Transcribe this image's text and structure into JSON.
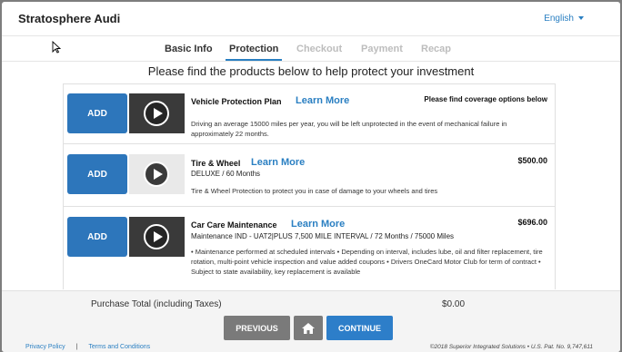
{
  "header": {
    "brand": "Stratosphere Audi",
    "language": "English"
  },
  "tabs": [
    {
      "label": "Basic Info",
      "state": "done"
    },
    {
      "label": "Protection",
      "state": "active"
    },
    {
      "label": "Checkout",
      "state": "pending"
    },
    {
      "label": "Payment",
      "state": "pending"
    },
    {
      "label": "Recap",
      "state": "pending"
    }
  ],
  "heading": "Please find the products below to help protect your investment",
  "products": [
    {
      "add_label": "ADD",
      "title": "Vehicle Protection Plan",
      "learn_more": "Learn More",
      "price": "Please find coverage options below",
      "subtitle": "",
      "description": "Driving an average 15000 miles per year, you will be left unprotected in the event of mechanical failure in approximately 22 months."
    },
    {
      "add_label": "ADD",
      "title": "Tire & Wheel",
      "learn_more": "Learn More",
      "price": "$500.00",
      "subtitle": "DELUXE / 60 Months",
      "description": "Tire & Wheel Protection to protect you in case of damage to your wheels and tires"
    },
    {
      "add_label": "ADD",
      "title": "Car Care Maintenance",
      "learn_more": "Learn More",
      "price": "$696.00",
      "subtitle": "Maintenance IND - UAT2|PLUS 7,500 MILE INTERVAL / 72 Months / 75000 Miles",
      "description": "• Maintenance performed at scheduled intervals • Depending on interval, includes lube, oil and filter replacement, tire rotation, multi-point vehicle inspection and value added coupons • Drivers OneCard Motor Club for term of contract • Subject to state availability, key replacement is available"
    }
  ],
  "footer": {
    "total_label": "Purchase Total (including Taxes)",
    "total_value": "$0.00",
    "previous": "PREVIOUS",
    "continue": "CONTINUE",
    "privacy": "Privacy Policy",
    "separator": "|",
    "terms": "Terms and Conditions",
    "copyright": "©2018 Superior Integrated Solutions • U.S. Pat. No. 9,747,611"
  },
  "colors": {
    "accent": "#2d76bb",
    "link": "#2a7fc2",
    "gray_button": "#7a7a7a"
  },
  "icons": [
    "play-icon",
    "home-icon",
    "chevron-down-icon",
    "cursor-icon"
  ]
}
